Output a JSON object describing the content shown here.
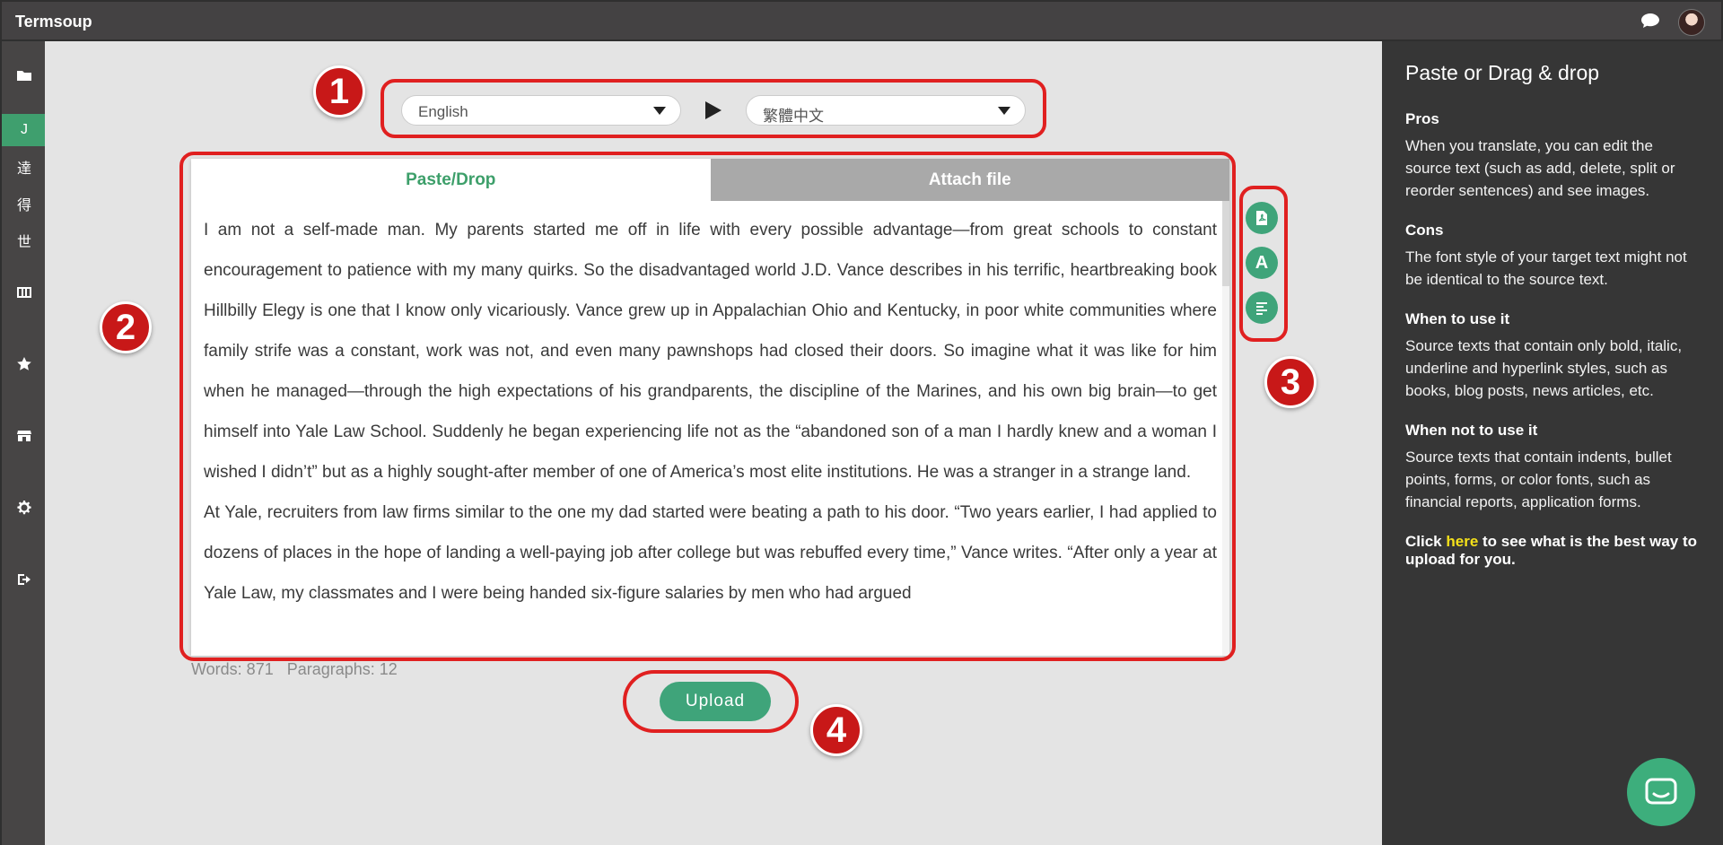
{
  "app": {
    "title": "Termsoup"
  },
  "sidebar": {
    "items": [
      {
        "icon": "folder-icon"
      },
      {
        "label": "J",
        "active": true
      },
      {
        "label": "達"
      },
      {
        "label": "得"
      },
      {
        "label": "世"
      },
      {
        "icon": "glossary-icon"
      },
      {
        "icon": "star-icon"
      },
      {
        "icon": "store-icon"
      },
      {
        "icon": "gear-icon"
      },
      {
        "icon": "logout-icon"
      }
    ]
  },
  "languages": {
    "source": "English",
    "target": "繁體中文"
  },
  "tabs": [
    {
      "label": "Paste/Drop",
      "active": true
    },
    {
      "label": "Attach file",
      "active": false
    }
  ],
  "editor": {
    "paragraphs": [
      "I am not a self-made man. My parents started me off in life with every possible advantage—from great schools to constant encouragement to patience with my many quirks. So the disadvantaged world J.D. Vance describes in his terrific, heartbreaking book Hillbilly Elegy is one that I know only vicariously. Vance grew up in Appalachian Ohio and Kentucky, in poor white communities where family strife was a constant, work was not, and even many pawnshops had closed their doors. So imagine what it was like for him when he managed—through the high expectations of his grandparents, the discipline of the Marines, and his own big brain—to get himself into Yale Law School. Suddenly he began experiencing life not as the “abandoned son of a man I hardly knew and a woman I wished I didn’t” but as a highly sought-after member of one of America’s most elite institutions. He was a stranger in a strange land.",
      "At Yale, recruiters from law firms similar to the one my dad started were beating a path to his door. “Two years earlier, I had applied to dozens of places in the hope of landing a well-paying job after college but was rebuffed every time,” Vance writes. “After only a year at Yale Law, my classmates and I were being handed six-figure salaries by men who had argued"
    ]
  },
  "tools": [
    {
      "icon": "pdf-icon"
    },
    {
      "icon": "font-icon",
      "label": "A"
    },
    {
      "icon": "align-text-icon"
    }
  ],
  "stats": {
    "words": "Words: 871",
    "paragraphs": "Paragraphs: 12"
  },
  "upload_label": "Upload",
  "annotations": [
    "1",
    "2",
    "3",
    "4"
  ],
  "help": {
    "title": "Paste or Drag & drop",
    "sections": [
      {
        "heading": "Pros",
        "body": "When you translate, you can edit the source text (such as add, delete, split or reorder sentences) and see images."
      },
      {
        "heading": "Cons",
        "body": "The font style of your target text might not be identical to the source text."
      },
      {
        "heading": "When to use it",
        "body": "Source texts that contain only bold, italic, underline and hyperlink styles, such as books, blog posts, news articles, etc."
      },
      {
        "heading": "When not to use it",
        "body": "Source texts that contain indents, bullet points, forms, or color fonts, such as financial reports, application forms."
      }
    ],
    "click_prefix": "Click ",
    "click_link": "here",
    "click_suffix": " to see what is the best way to upload for you."
  },
  "colors": {
    "accent": "#3fa47a",
    "annotation": "#e02020",
    "panel": "#363636",
    "link": "#f5e11a"
  }
}
